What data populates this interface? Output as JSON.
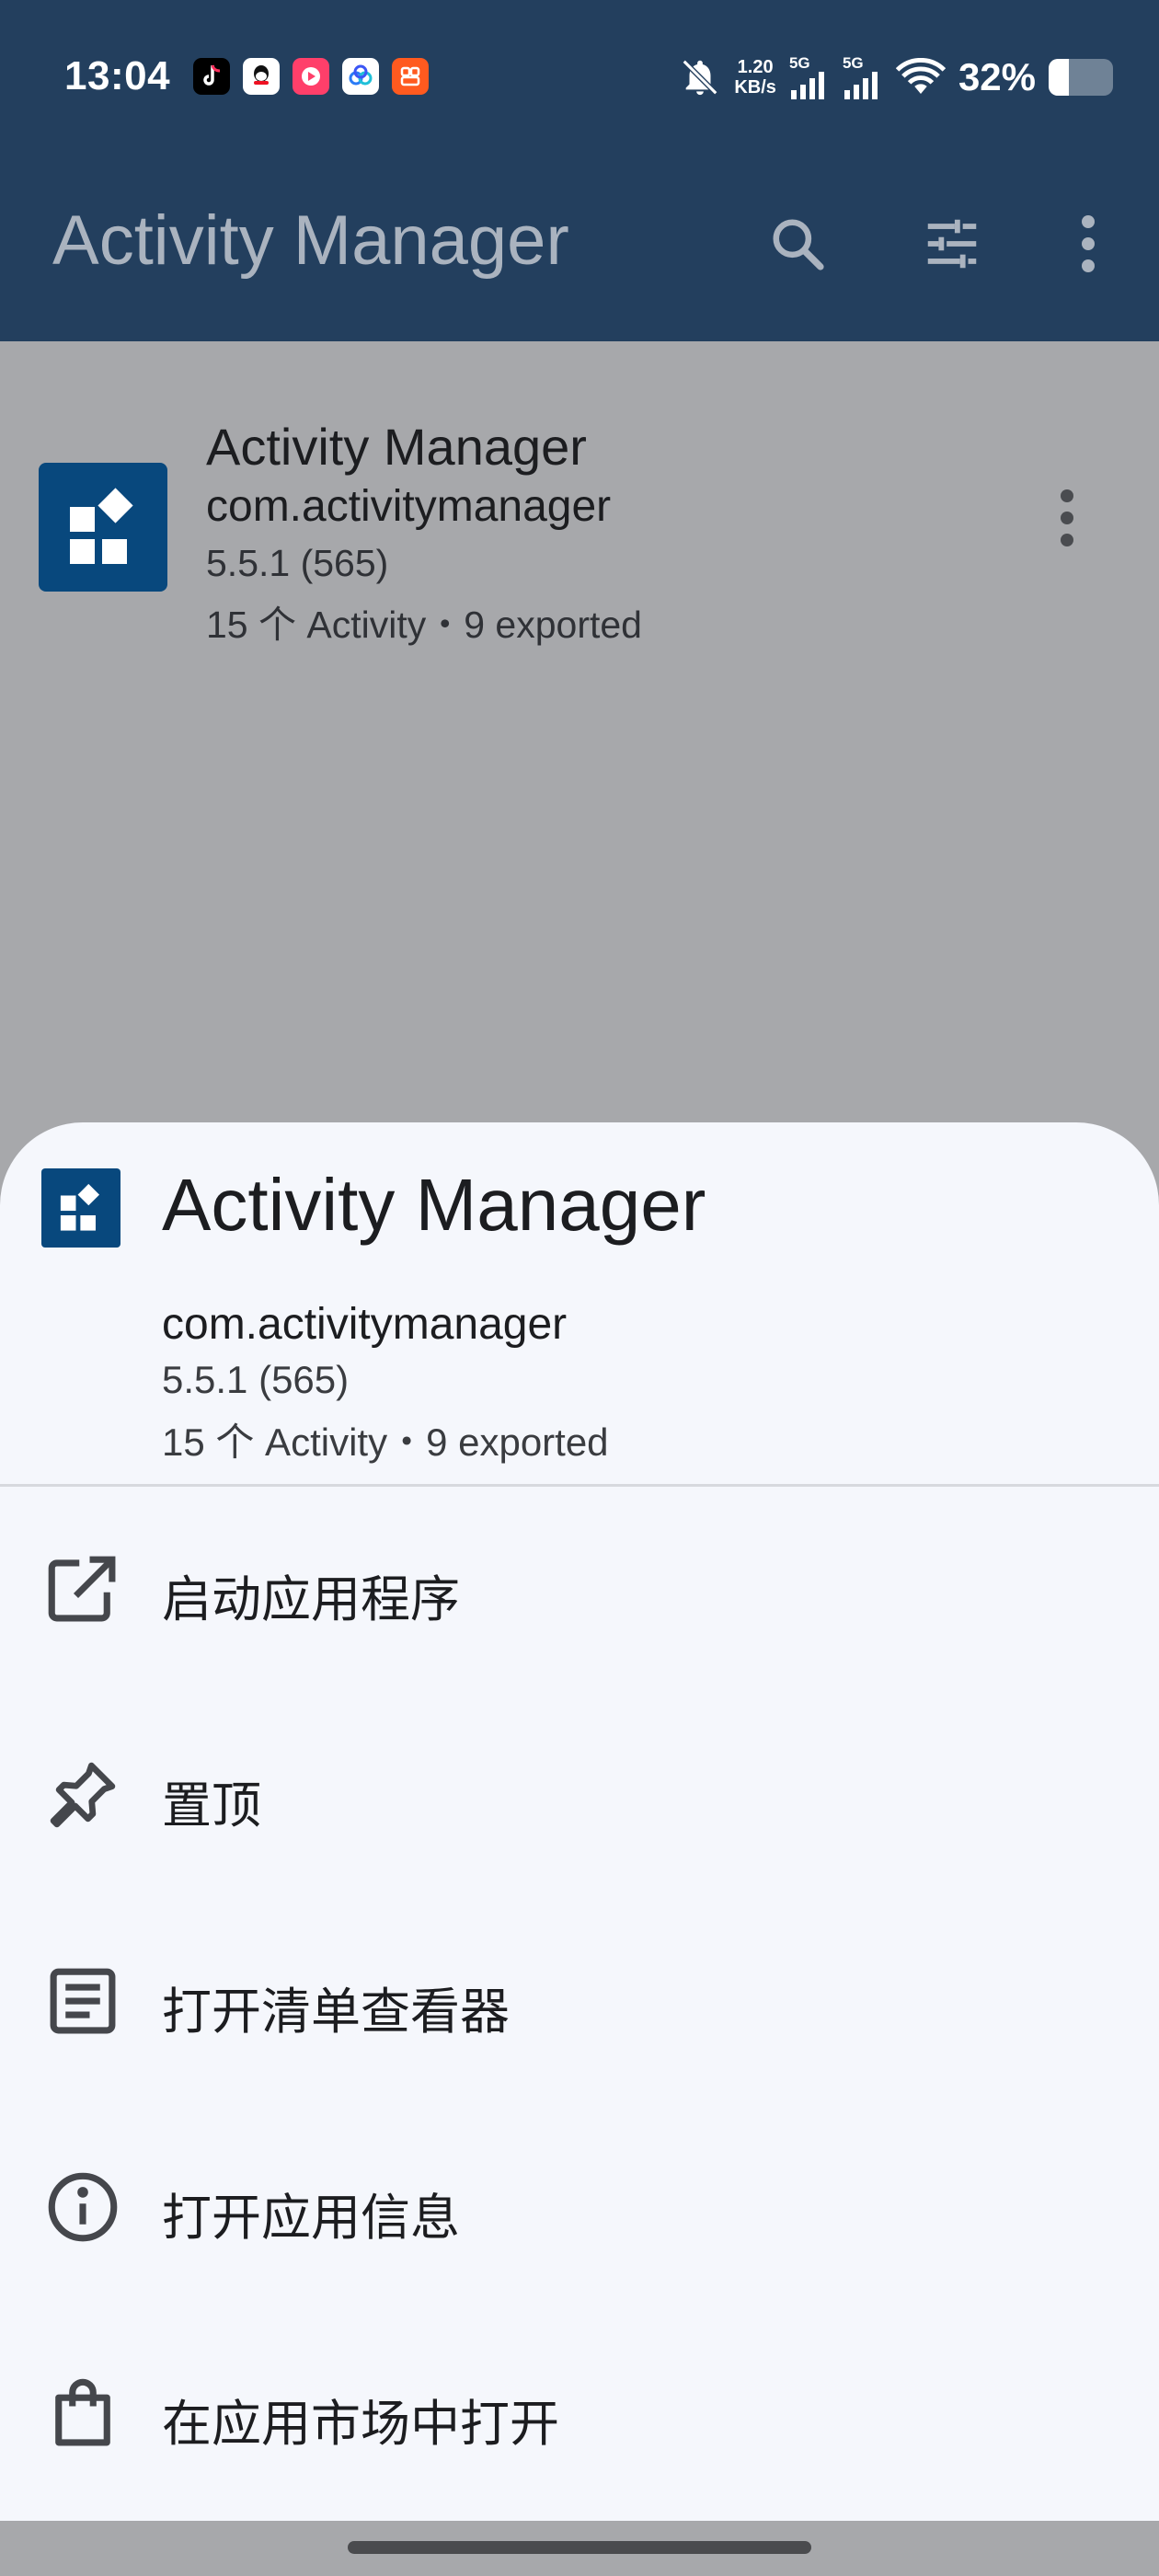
{
  "status_bar": {
    "time": "13:04",
    "net_speed_value": "1.20",
    "net_speed_unit": "KB/s",
    "signal1_label": "5G",
    "signal2_label": "5G",
    "battery_text": "32%",
    "battery_level": 0.32,
    "notification_icons": [
      "tiktok-icon",
      "qq-icon",
      "video-app-icon",
      "cloud-app-icon",
      "orange-app-icon"
    ]
  },
  "app_bar": {
    "title": "Activity Manager",
    "search_icon": "search-icon",
    "filter_icon": "tune-icon",
    "more_icon": "more-vert-icon"
  },
  "list": {
    "items": [
      {
        "name": "Activity Manager",
        "package": "com.activitymanager",
        "version": "5.5.1 (565)",
        "activity_count": "15 个 Activity・9 exported"
      }
    ]
  },
  "sheet": {
    "title": "Activity Manager",
    "package": "com.activitymanager",
    "version": "5.5.1 (565)",
    "activity_count": "15 个 Activity・9 exported",
    "menu": [
      {
        "label": "启动应用程序",
        "icon": "open-in-new-icon"
      },
      {
        "label": "置顶",
        "icon": "pin-icon"
      },
      {
        "label": "打开清单查看器",
        "icon": "article-icon"
      },
      {
        "label": "打开应用信息",
        "icon": "info-icon"
      },
      {
        "label": "在应用市场中打开",
        "icon": "shopping-bag-icon"
      }
    ]
  },
  "colors": {
    "app_bar": "#233f5e",
    "scrim": "#a7a8ab",
    "sheet": "#f5f7fc",
    "app_icon": "#08487d"
  }
}
